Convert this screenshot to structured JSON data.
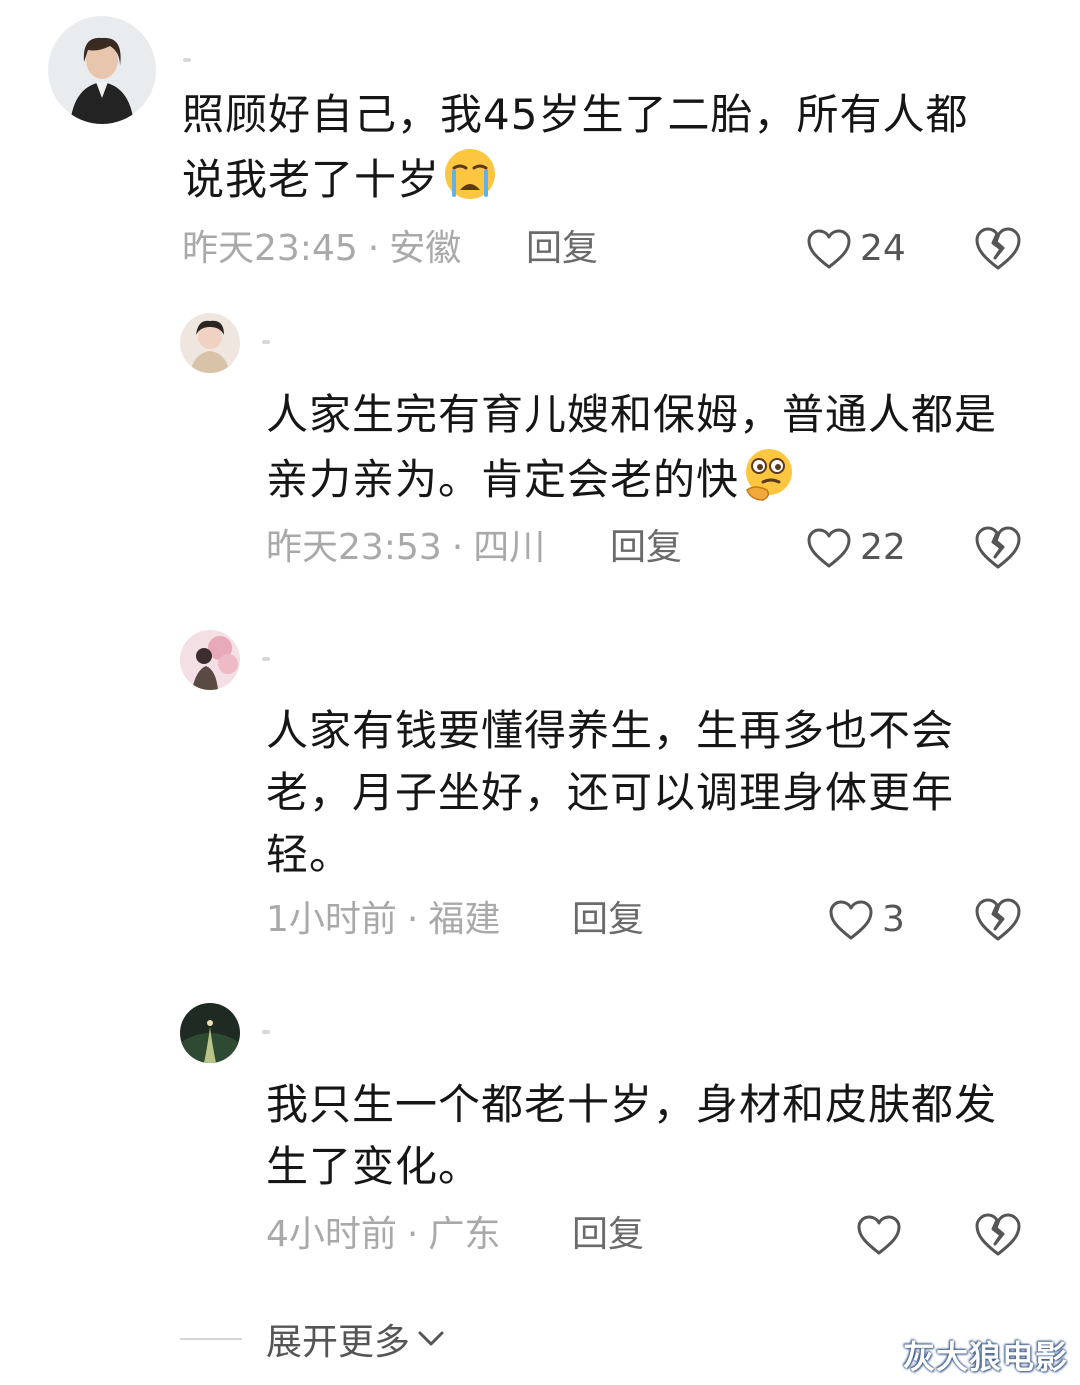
{
  "comments": [
    {
      "lines": [
        "照顾好自己，我45岁生了二胎，所有人都",
        "说我老了十岁"
      ],
      "emoji": "crying-face-emoji",
      "time": "昨天23:45",
      "location": "安徽",
      "reply_label": "回复",
      "likes": "24"
    },
    {
      "lines": [
        "人家生完有育儿嫂和保姆，普通人都是",
        "亲力亲为。肯定会老的快"
      ],
      "emoji": "thinking-face-emoji",
      "time": "昨天23:53",
      "location": "四川",
      "reply_label": "回复",
      "likes": "22"
    },
    {
      "lines": [
        "人家有钱要懂得养生，生再多也不会",
        "老，月子坐好，还可以调理身体更年",
        "轻。"
      ],
      "time": "1小时前",
      "location": "福建",
      "reply_label": "回复",
      "likes": "3"
    },
    {
      "lines": [
        "我只生一个都老十岁，身材和皮肤都发",
        "生了变化。"
      ],
      "time": "4小时前",
      "location": "广东",
      "reply_label": "回复",
      "likes": ""
    }
  ],
  "separator": "·",
  "expand_more_label": "展开更多",
  "watermark": "灰大狼电影",
  "colors": {
    "text": "#161616",
    "meta": "#a9a9a9",
    "reply": "#6b6b6b",
    "icon": "#555555"
  }
}
